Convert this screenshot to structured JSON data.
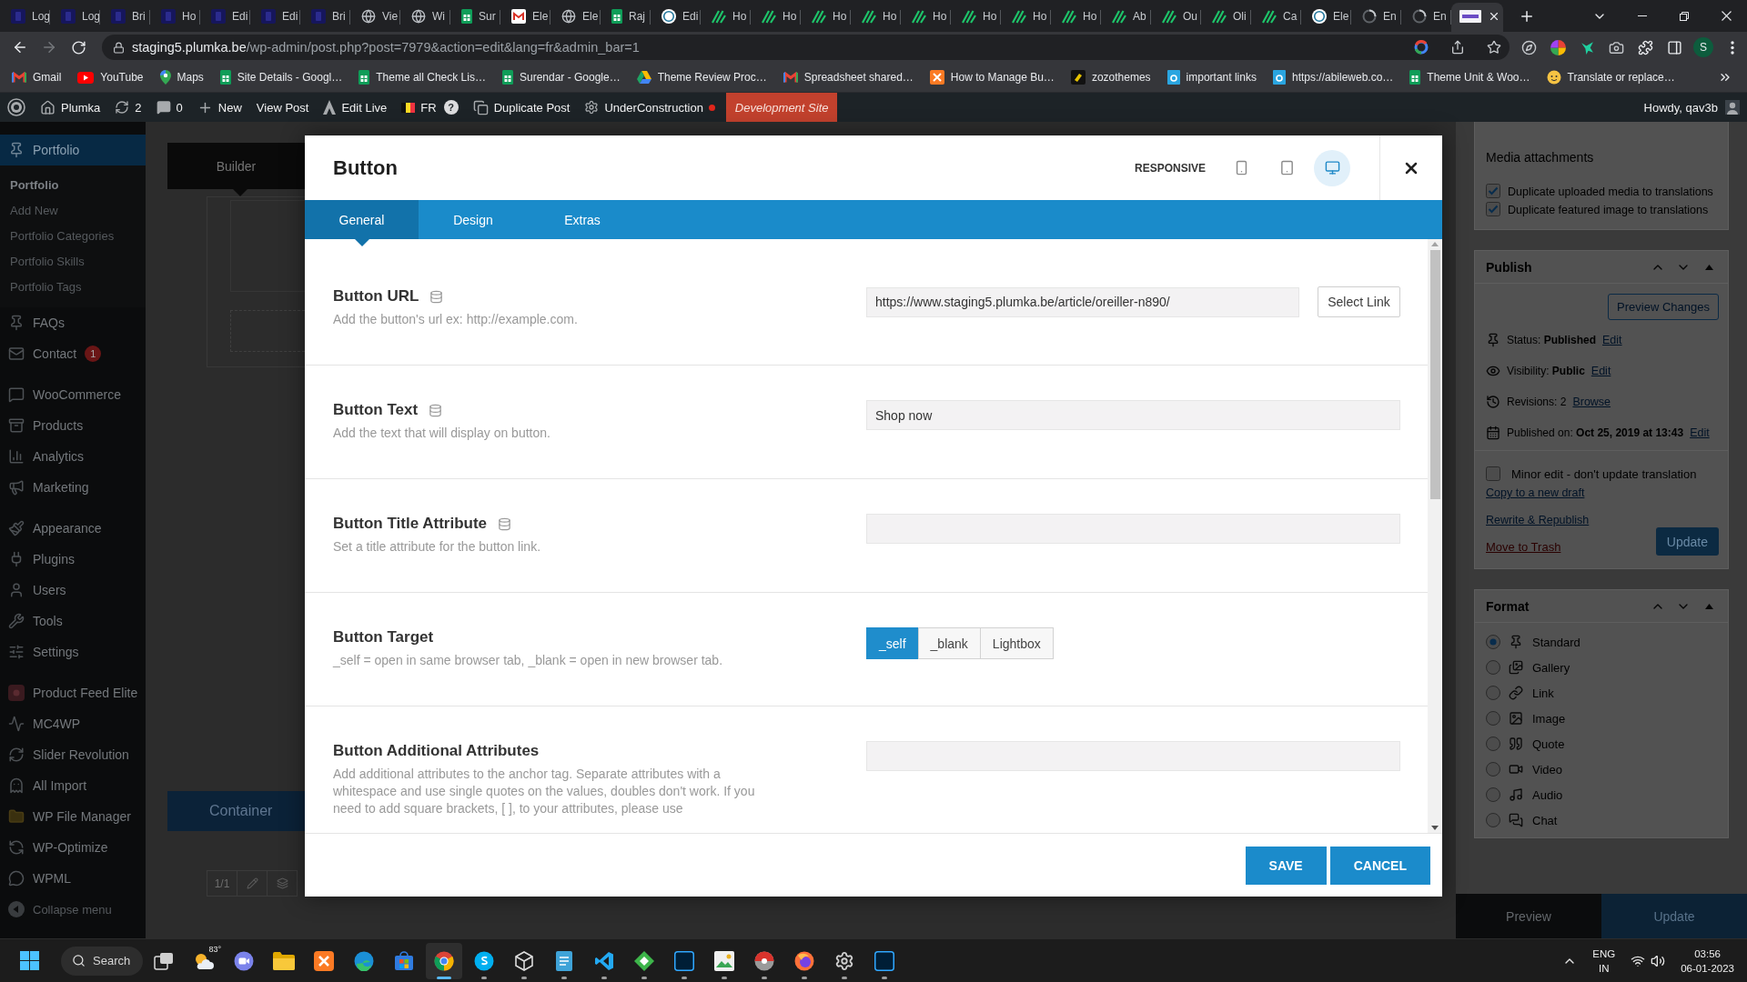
{
  "browser": {
    "tabs": [
      {
        "title": "Log",
        "kind": "square",
        "selected": false
      },
      {
        "title": "Log",
        "kind": "square",
        "selected": false
      },
      {
        "title": "Bri",
        "kind": "square",
        "selected": false
      },
      {
        "title": "Ho",
        "kind": "square",
        "selected": false
      },
      {
        "title": "Edi",
        "kind": "square",
        "selected": false
      },
      {
        "title": "Edi",
        "kind": "square",
        "selected": false
      },
      {
        "title": "Bri",
        "kind": "square",
        "selected": false
      },
      {
        "title": "Vie",
        "kind": "globe",
        "selected": false
      },
      {
        "title": "Wi",
        "kind": "globe",
        "selected": false
      },
      {
        "title": "Sur",
        "kind": "sheet",
        "selected": false
      },
      {
        "title": "Ele",
        "kind": "mail",
        "selected": false
      },
      {
        "title": "Ele",
        "kind": "globe",
        "selected": false
      },
      {
        "title": "Raj",
        "kind": "sheet",
        "selected": false
      },
      {
        "title": "Edi",
        "kind": "round",
        "selected": false
      },
      {
        "title": "Ho",
        "kind": "slashes",
        "selected": false
      },
      {
        "title": "Ho",
        "kind": "slashes",
        "selected": false
      },
      {
        "title": "Ho",
        "kind": "slashes",
        "selected": false
      },
      {
        "title": "Ho",
        "kind": "slashes",
        "selected": false
      },
      {
        "title": "Ho",
        "kind": "slashes",
        "selected": false
      },
      {
        "title": "Ho",
        "kind": "slashes",
        "selected": false
      },
      {
        "title": "Ho",
        "kind": "slashes",
        "selected": false
      },
      {
        "title": "Ho",
        "kind": "slashes",
        "selected": false
      },
      {
        "title": "Ab",
        "kind": "slashes",
        "selected": false
      },
      {
        "title": "Ou",
        "kind": "slashes",
        "selected": false
      },
      {
        "title": "Oli",
        "kind": "slashes",
        "selected": false
      },
      {
        "title": "Ca",
        "kind": "slashes",
        "selected": false
      },
      {
        "title": "Ele",
        "kind": "round",
        "selected": false
      },
      {
        "title": "En",
        "kind": "spinner",
        "selected": false
      },
      {
        "title": "En",
        "kind": "spinner",
        "selected": false
      },
      {
        "kind": "logo",
        "selected": true
      }
    ],
    "address": {
      "host": "staging5.plumka.be",
      "path": "/wp-admin/post.php?post=7979&action=edit&lang=fr&admin_bar=1"
    },
    "profile": "S",
    "bookmarks": [
      {
        "label": "Gmail",
        "kind": "mail"
      },
      {
        "label": "YouTube",
        "kind": "play"
      },
      {
        "label": "Maps",
        "kind": "pin"
      },
      {
        "label": "Site Details - Googl…",
        "kind": "sheet"
      },
      {
        "label": "Theme all Check Lis…",
        "kind": "sheet"
      },
      {
        "label": "Surendar - Google…",
        "kind": "sheet"
      },
      {
        "label": "Theme Review Proc…",
        "kind": "drive"
      },
      {
        "label": "Spreadsheet shared…",
        "kind": "mail"
      },
      {
        "label": "How to Manage Bu…",
        "kind": "cross"
      },
      {
        "label": "zozothemes",
        "kind": "dark"
      },
      {
        "label": "important links",
        "kind": "tile"
      },
      {
        "label": "https://abileweb.co…",
        "kind": "tile"
      },
      {
        "label": "Theme Unit & Woo…",
        "kind": "sheet"
      },
      {
        "label": "Translate or replace…",
        "kind": "face"
      }
    ]
  },
  "admin_bar": {
    "site": "Plumka",
    "updates": "2",
    "comments": "0",
    "new": "New",
    "view_post": "View Post",
    "edit_live": "Edit Live",
    "language": "FR",
    "help": "?",
    "duplicate": "Duplicate Post",
    "maintenance": "UnderConstruction",
    "maintenance_on": true,
    "environment": "Development Site",
    "greeting": "Howdy, qav3b"
  },
  "sidebar": {
    "groups": [
      {
        "items": [
          {
            "label": "Portfolio",
            "kind": "pin",
            "selected": true,
            "children": [
              {
                "label": "Portfolio",
                "selected": true
              },
              {
                "label": "Add New",
                "selected": false
              },
              {
                "label": "Portfolio Categories",
                "selected": false
              },
              {
                "label": "Portfolio Skills",
                "selected": false
              },
              {
                "label": "Portfolio Tags",
                "selected": false
              }
            ]
          },
          {
            "label": "FAQs",
            "kind": "pin",
            "selected": false
          },
          {
            "label": "Contact",
            "kind": "mail",
            "selected": false,
            "badge": "1"
          }
        ]
      },
      {
        "items": [
          {
            "label": "WooCommerce",
            "kind": "bubble",
            "selected": false
          },
          {
            "label": "Products",
            "kind": "box",
            "selected": false
          },
          {
            "label": "Analytics",
            "kind": "bars",
            "selected": false
          },
          {
            "label": "Marketing",
            "kind": "megaphone",
            "selected": false
          }
        ]
      },
      {
        "items": [
          {
            "label": "Appearance",
            "kind": "brush",
            "selected": false
          },
          {
            "label": "Plugins",
            "kind": "plug",
            "selected": false
          },
          {
            "label": "Users",
            "kind": "user",
            "selected": false
          },
          {
            "label": "Tools",
            "kind": "wrench",
            "selected": false
          },
          {
            "label": "Settings",
            "kind": "sliders",
            "selected": false
          }
        ]
      },
      {
        "items": [
          {
            "label": "Product Feed Elite",
            "kind": "tile",
            "selected": false
          },
          {
            "label": "MC4WP",
            "kind": "pulse",
            "selected": false
          },
          {
            "label": "Slider Revolution",
            "kind": "refresh",
            "selected": false
          },
          {
            "label": "All Import",
            "kind": "ghost",
            "selected": false
          },
          {
            "label": "WP File Manager",
            "kind": "folder",
            "selected": false
          },
          {
            "label": "WP-Optimize",
            "kind": "cycle",
            "selected": false
          },
          {
            "label": "WPML",
            "kind": "speech",
            "selected": false
          }
        ]
      }
    ],
    "collapse": "Collapse menu"
  },
  "builder": {
    "tab": "Builder",
    "container": "Container",
    "pager": "1/1"
  },
  "modal": {
    "title": "Button",
    "responsive_label": "RESPONSIVE",
    "devices": [
      {
        "kind": "phone",
        "selected": false
      },
      {
        "kind": "tablet",
        "selected": false
      },
      {
        "kind": "desktop",
        "selected": true
      }
    ],
    "tabs": [
      {
        "label": "General",
        "selected": true
      },
      {
        "label": "Design",
        "selected": false
      },
      {
        "label": "Extras",
        "selected": false
      }
    ],
    "fields": [
      {
        "kind": "link",
        "label": "Button URL",
        "dynamic": true,
        "description": "Add the button's url ex: http://example.com.",
        "value": "https://www.staging5.plumka.be/article/oreiller-n890/",
        "action": "Select Link"
      },
      {
        "kind": "text",
        "label": "Button Text",
        "dynamic": true,
        "description": "Add the text that will display on button.",
        "value": "Shop now"
      },
      {
        "kind": "text",
        "label": "Button Title Attribute",
        "dynamic": true,
        "description": "Set a title attribute for the button link."
      },
      {
        "kind": "choice",
        "label": "Button Target",
        "dynamic": false,
        "description": "_self = open in same browser tab, _blank = open in new browser tab.",
        "options": [
          {
            "label": "_self",
            "selected": true
          },
          {
            "label": "_blank",
            "selected": false
          },
          {
            "label": "Lightbox",
            "selected": false
          }
        ]
      },
      {
        "kind": "text",
        "label": "Button Additional Attributes",
        "dynamic": false,
        "description": "Add additional attributes to the anchor tag. Separate attributes with a whitespace and use single quotes on the values, doubles don't work. If you need to add square brackets, [ ], to your attributes, please use"
      }
    ],
    "actions": [
      {
        "label": "SAVE"
      },
      {
        "label": "CANCEL"
      }
    ]
  },
  "media": {
    "heading": "Media attachments",
    "options": [
      {
        "label": "Duplicate uploaded media to translations",
        "checked": true
      },
      {
        "label": "Duplicate featured image to translations",
        "checked": true
      }
    ]
  },
  "publish": {
    "heading": "Publish",
    "preview": "Preview Changes",
    "meta": [
      {
        "kind": "pin",
        "text": "Status: **Published**",
        "link": "Edit"
      },
      {
        "kind": "eye",
        "text": "Visibility: **Public**",
        "link": "Edit"
      },
      {
        "kind": "history",
        "text": "Revisions: 2",
        "link": "Browse"
      },
      {
        "kind": "calendar",
        "text": "Published on: **Oct 25, 2019 at 13:43**",
        "link": "Edit"
      }
    ],
    "minor_edit": {
      "label": "Minor edit - don't update translation",
      "checked": false
    },
    "links": [
      "Copy to a new draft",
      "Rewrite & Republish"
    ],
    "trash": "Move to Trash",
    "update": "Update"
  },
  "format": {
    "heading": "Format",
    "options": [
      {
        "label": "Standard",
        "kind": "pin",
        "selected": true
      },
      {
        "label": "Gallery",
        "kind": "gallery",
        "selected": false
      },
      {
        "label": "Link",
        "kind": "link",
        "selected": false
      },
      {
        "label": "Image",
        "kind": "image",
        "selected": false
      },
      {
        "label": "Quote",
        "kind": "quote",
        "selected": false
      },
      {
        "label": "Video",
        "kind": "video",
        "selected": false
      },
      {
        "label": "Audio",
        "kind": "audio",
        "selected": false
      },
      {
        "label": "Chat",
        "kind": "chat",
        "selected": false
      }
    ]
  },
  "bottom_bar": {
    "preview": "Preview",
    "update": "Update"
  },
  "taskbar": {
    "search": "Search",
    "apps": [
      {
        "kind": "task-view",
        "running": false,
        "selected": false
      },
      {
        "kind": "weather",
        "label": "83°",
        "running": false,
        "selected": false
      },
      {
        "kind": "chat",
        "running": false,
        "selected": false
      },
      {
        "kind": "folder",
        "running": false,
        "selected": false
      },
      {
        "kind": "cross",
        "running": false,
        "selected": false
      },
      {
        "kind": "swirl",
        "running": false,
        "selected": false
      },
      {
        "kind": "store",
        "running": false,
        "selected": false
      },
      {
        "kind": "ball-browser",
        "running": true,
        "selected": true
      },
      {
        "kind": "bubble",
        "running": true,
        "selected": false
      },
      {
        "kind": "cube",
        "running": true,
        "selected": false
      },
      {
        "kind": "notepad",
        "running": true,
        "selected": false
      },
      {
        "kind": "code",
        "running": true,
        "selected": false
      },
      {
        "kind": "diamond",
        "running": true,
        "selected": false
      },
      {
        "kind": "tile",
        "running": true,
        "selected": false
      },
      {
        "kind": "image",
        "running": true,
        "selected": false
      },
      {
        "kind": "ball",
        "running": true,
        "selected": false
      },
      {
        "kind": "fox",
        "running": true,
        "selected": false
      },
      {
        "kind": "gear",
        "running": true,
        "selected": false
      },
      {
        "kind": "tile",
        "running": true,
        "selected": false
      }
    ],
    "language": "ENG",
    "region": "IN",
    "time": "03:56",
    "date": "06-01-2023"
  }
}
